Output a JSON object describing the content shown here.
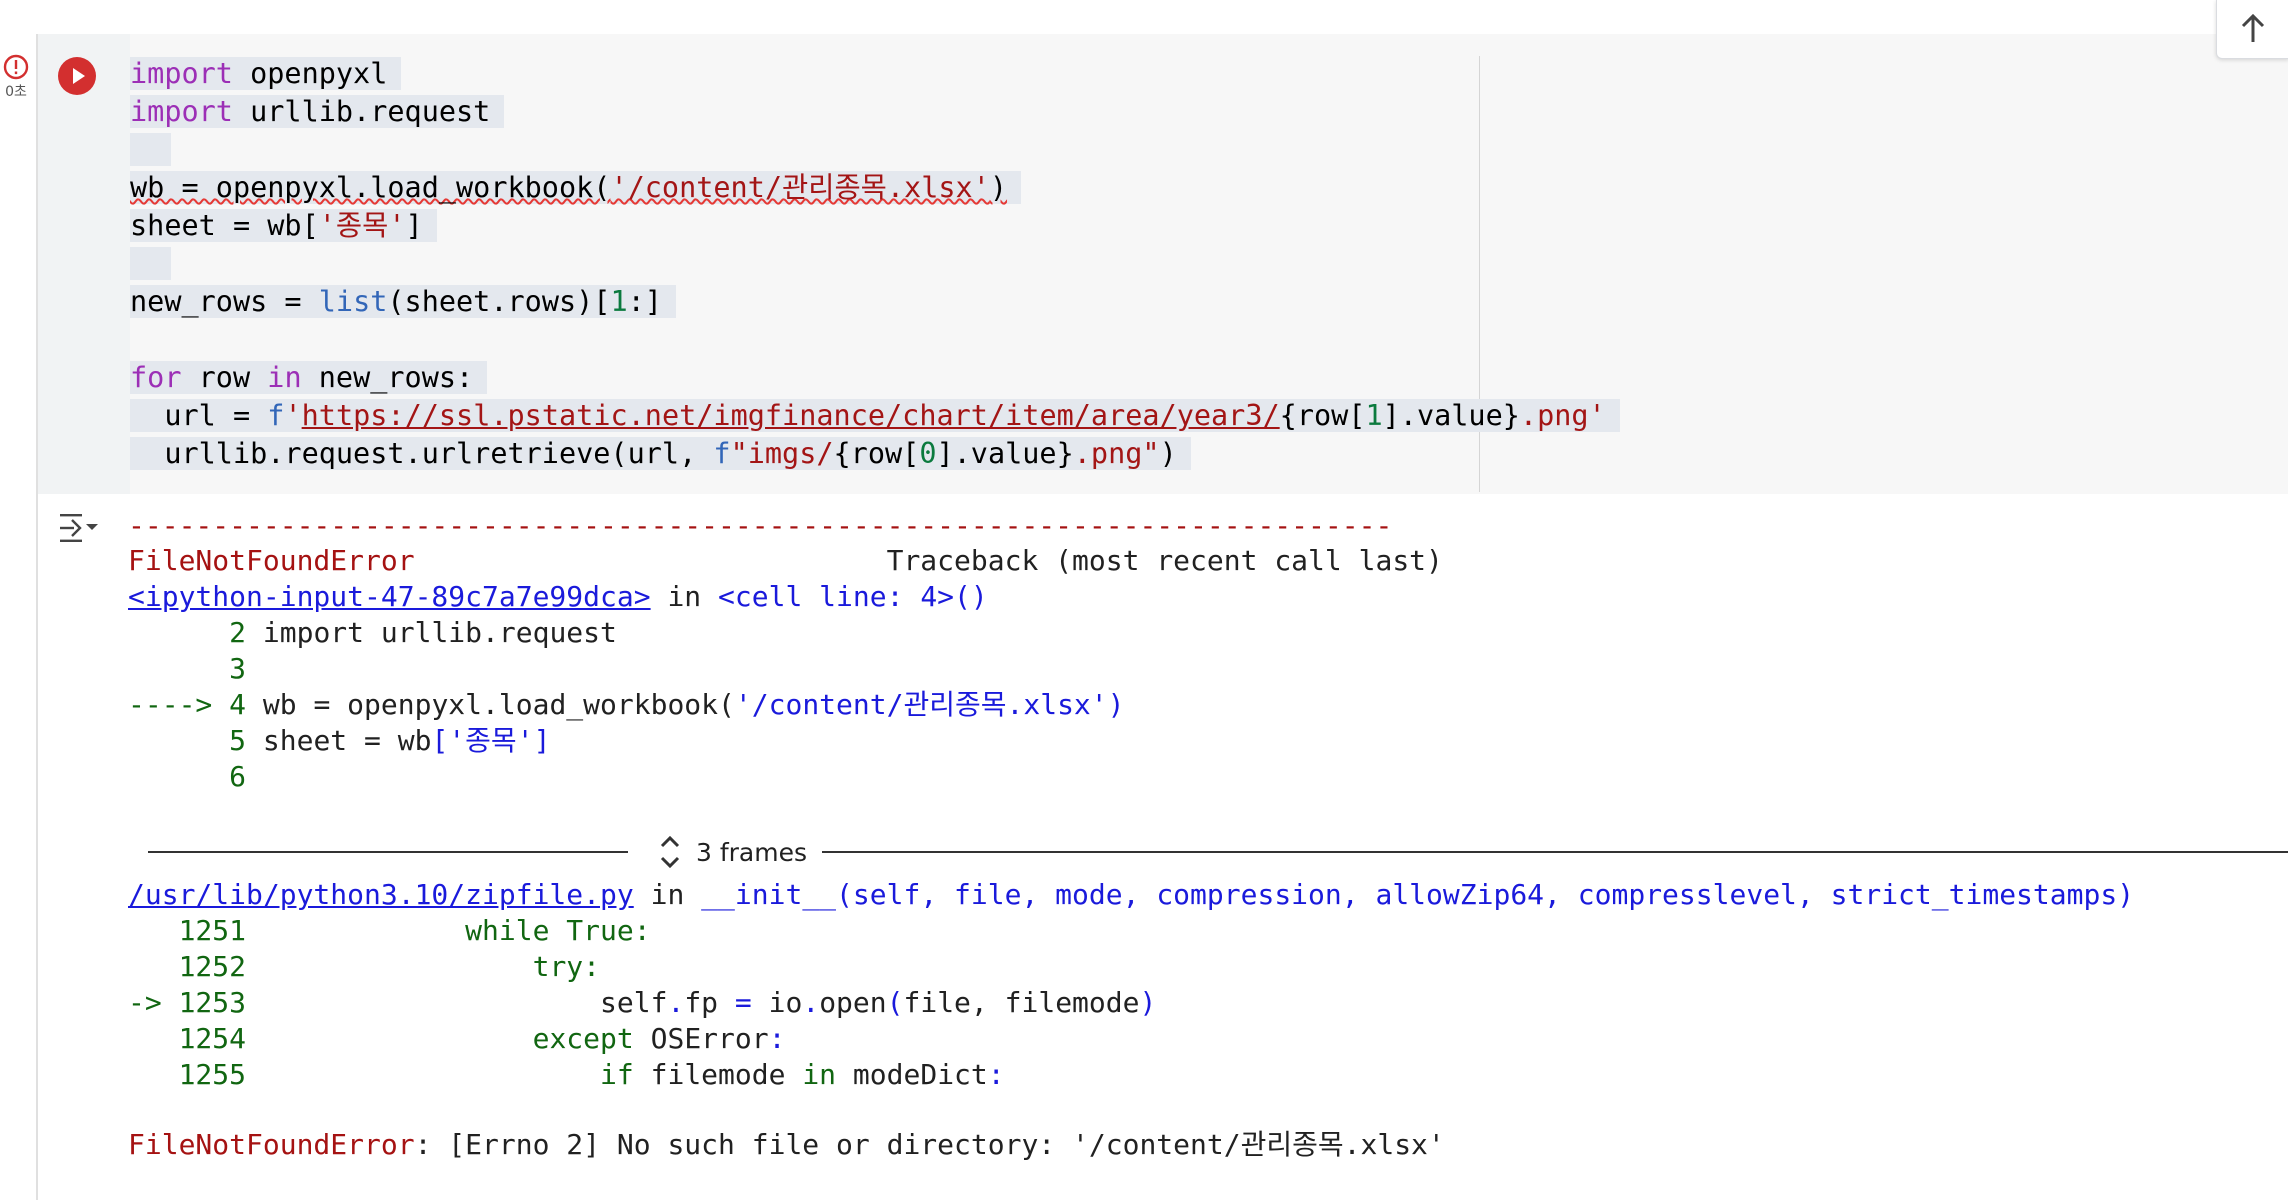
{
  "cell": {
    "exec_time": "0초",
    "code_lines": [
      "import openpyxl",
      "import urllib.request",
      "",
      "wb = openpyxl.load_workbook('/content/관리종목.xlsx')",
      "sheet = wb['종목']",
      "",
      "new_rows = list(sheet.rows)[1:]",
      "",
      "for row in new_rows:",
      "  url = f'https://ssl.pstatic.net/imgfinance/chart/item/area/year3/{row[1].value}.png'",
      "  urllib.request.urlretrieve(url, f\"imgs/{row[0].value}.png\")"
    ]
  },
  "output": {
    "dash_line": "---------------------------------------------------------------------------",
    "error_type": "FileNotFoundError",
    "traceback_header": "Traceback (most recent call last)",
    "frame1": {
      "file_link": "<ipython-input-47-89c7a7e99dca>",
      "in_text": " in ",
      "location": "<cell line: 4>()",
      "lines": [
        {
          "marker": "      ",
          "num": "2",
          "code": "import urllib.request"
        },
        {
          "marker": "      ",
          "num": "3",
          "code": ""
        },
        {
          "marker": "----> ",
          "num": "4",
          "code": "wb = openpyxl.load_workbook('/content/관리종목.xlsx')"
        },
        {
          "marker": "      ",
          "num": "5",
          "code": "sheet = wb['종목']"
        },
        {
          "marker": "      ",
          "num": "6",
          "code": ""
        }
      ]
    },
    "frames_toggle_label": "3 frames",
    "frame2": {
      "file_link": "/usr/lib/python3.10/zipfile.py",
      "in_text": " in ",
      "location": "__init__(self, file, mode, compression, allowZip64, compresslevel, strict_timestamps)",
      "lines": [
        {
          "marker": "   ",
          "num": "1251",
          "code": "            while True:"
        },
        {
          "marker": "   ",
          "num": "1252",
          "code": "                try:"
        },
        {
          "marker": "-> ",
          "num": "1253",
          "code": "                    self.fp = io.open(file, filemode)"
        },
        {
          "marker": "   ",
          "num": "1254",
          "code": "                except OSError:"
        },
        {
          "marker": "   ",
          "num": "1255",
          "code": "                    if filemode in modeDict:"
        }
      ]
    },
    "final_error_type": "FileNotFoundError",
    "final_error_message": ": [Errno 2] No such file or directory: '/content/관리종목.xlsx'"
  },
  "colors": {
    "run_button": "#d32f2f",
    "error_red": "#a51212",
    "link_blue": "#1a1adb",
    "line_number_green": "#116611",
    "keyword_purple": "#9c2fb6",
    "string_red": "#a31515"
  },
  "icons": [
    "error-status-icon",
    "run-icon",
    "output-toggle-icon",
    "chevron-up-down-icon",
    "arrow-up-icon"
  ]
}
